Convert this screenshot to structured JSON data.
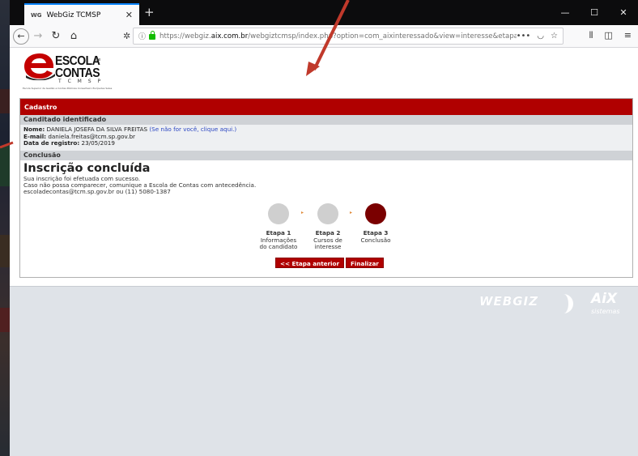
{
  "browser": {
    "tab_title": "WebGiz TCMSP",
    "tab_favicon": "WG",
    "url_host": "https://webgiz.",
    "url_domain": "aix.com.br",
    "url_rest": "/webgiztcmsp/index.php?option=com_aixinteressado&view=interesse&etapa=conclusao",
    "new_tab_symbol": "+",
    "back_icon": "arrow-left-icon",
    "forward_icon": "arrow-right-icon",
    "reload_icon": "reload-icon",
    "home_icon": "home-icon",
    "menu_dots": "•••"
  },
  "logo": {
    "line1": "ESCOLA",
    "line2": "CONTAS",
    "de": "de",
    "sub": "T C M S P",
    "tagline": "Escola Superior de Gestão e Contas Públicas Conselheiro Eurípedes Sales"
  },
  "panel": {
    "header": "Cadastro",
    "section_identified": "Canditado identificado",
    "name_label": "Nome:",
    "name_value": "DANIELA JOSEFA DA SILVA FREITAS",
    "not_you_link": "(Se não for você, clique aqui.)",
    "email_label": "E-mail:",
    "email_value": "daniela.freitas@tcm.sp.gov.br",
    "date_label": "Data de registro:",
    "date_value": "23/05/2019",
    "section_conclusion": "Conclusão",
    "title": "Inscrição concluída",
    "msg1": "Sua inscrição foi efetuada com sucesso.",
    "msg2": "Caso não possa comparecer, comunique a Escola de Contas com antecedência.",
    "msg3": "escoladecontas@tcm.sp.gov.br ou (11) 5080-1387"
  },
  "steps": [
    {
      "title": "Etapa 1",
      "line1": "Informações",
      "line2": "do candidato",
      "color": "#cfcfcf"
    },
    {
      "title": "Etapa 2",
      "line1": "Cursos de",
      "line2": "interesse",
      "color": "#cfcfcf"
    },
    {
      "title": "Etapa 3",
      "line1": "Conclusão",
      "line2": "",
      "color": "#7a0000"
    }
  ],
  "step_arrow": "▸",
  "buttons": {
    "previous": "<< Etapa anterior",
    "finish": "Finalizar"
  },
  "footer": {
    "webgiz": "WEBGIZ",
    "aix": "AiX",
    "aix_sub": "sistemas"
  },
  "colors": {
    "brand_red": "#b00000",
    "annotation": "#c0392b"
  }
}
